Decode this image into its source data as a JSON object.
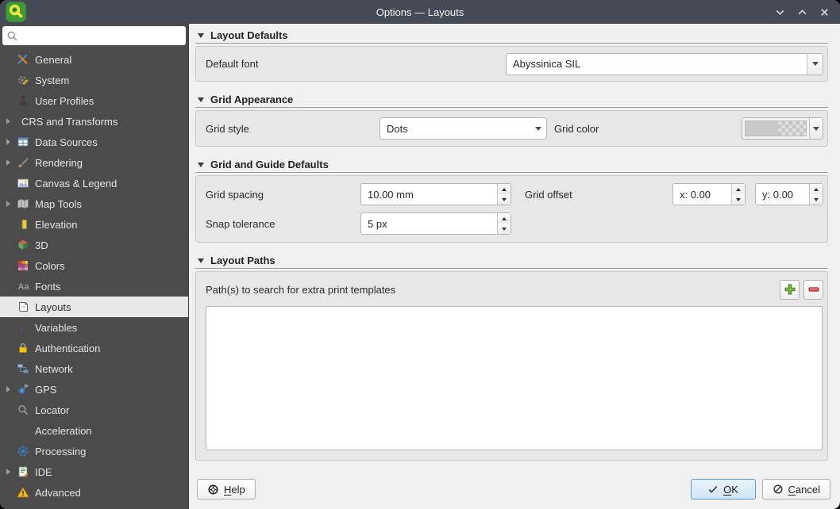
{
  "window": {
    "title": "Options — Layouts",
    "controls": {
      "minimize": "chevron-down-icon",
      "maximize": "chevron-up-icon",
      "close": "close-icon"
    }
  },
  "sidebar": {
    "search": {
      "value": "",
      "icon": "search-icon"
    },
    "items": [
      {
        "label": "General",
        "icon": "general-icon",
        "expandable": false,
        "selected": false
      },
      {
        "label": "System",
        "icon": "system-icon",
        "expandable": false,
        "selected": false
      },
      {
        "label": "User Profiles",
        "icon": "user-profiles-icon",
        "expandable": false,
        "selected": false
      },
      {
        "label": "CRS and Transforms",
        "icon": null,
        "expandable": true,
        "selected": false
      },
      {
        "label": "Data Sources",
        "icon": "data-sources-icon",
        "expandable": true,
        "selected": false
      },
      {
        "label": "Rendering",
        "icon": "rendering-icon",
        "expandable": true,
        "selected": false
      },
      {
        "label": "Canvas & Legend",
        "icon": "canvas-legend-icon",
        "expandable": false,
        "selected": false
      },
      {
        "label": "Map Tools",
        "icon": "map-tools-icon",
        "expandable": true,
        "selected": false
      },
      {
        "label": "Elevation",
        "icon": "elevation-icon",
        "expandable": false,
        "selected": false
      },
      {
        "label": "3D",
        "icon": "cube-3d-icon",
        "expandable": false,
        "selected": false
      },
      {
        "label": "Colors",
        "icon": "colors-icon",
        "expandable": false,
        "selected": false
      },
      {
        "label": "Fonts",
        "icon": "fonts-icon",
        "expandable": false,
        "selected": false
      },
      {
        "label": "Layouts",
        "icon": "layouts-icon",
        "expandable": false,
        "selected": true
      },
      {
        "label": "Variables",
        "icon": "variables-icon",
        "expandable": false,
        "selected": false
      },
      {
        "label": "Authentication",
        "icon": "authentication-icon",
        "expandable": false,
        "selected": false
      },
      {
        "label": "Network",
        "icon": "network-icon",
        "expandable": false,
        "selected": false
      },
      {
        "label": "GPS",
        "icon": "gps-icon",
        "expandable": true,
        "selected": false
      },
      {
        "label": "Locator",
        "icon": "locator-icon",
        "expandable": false,
        "selected": false
      },
      {
        "label": "Acceleration",
        "icon": "acceleration-icon",
        "expandable": false,
        "selected": false
      },
      {
        "label": "Processing",
        "icon": "processing-icon",
        "expandable": false,
        "selected": false
      },
      {
        "label": "IDE",
        "icon": "ide-icon",
        "expandable": true,
        "selected": false
      },
      {
        "label": "Advanced",
        "icon": "advanced-icon",
        "expandable": false,
        "selected": false
      }
    ]
  },
  "sections": {
    "layout_defaults": {
      "title": "Layout Defaults",
      "default_font_label": "Default font",
      "default_font_value": "Abyssinica SIL"
    },
    "grid_appearance": {
      "title": "Grid Appearance",
      "grid_style_label": "Grid style",
      "grid_style_value": "Dots",
      "grid_color_label": "Grid color",
      "grid_color_value": "semi-transparent gray swatch with alpha checkerboard"
    },
    "grid_guide_defaults": {
      "title": "Grid and Guide Defaults",
      "grid_spacing_label": "Grid spacing",
      "grid_spacing_value": "10.00 mm",
      "grid_offset_label": "Grid offset",
      "grid_offset_x": "x: 0.00",
      "grid_offset_y": "y: 0.00",
      "snap_tolerance_label": "Snap tolerance",
      "snap_tolerance_value": "5 px"
    },
    "layout_paths": {
      "title": "Layout Paths",
      "paths_label": "Path(s) to search for extra print templates",
      "paths": [],
      "add_icon": "plus-icon",
      "remove_icon": "minus-icon"
    }
  },
  "footer": {
    "help": "Help",
    "help_icon": "help-icon",
    "ok": "OK",
    "ok_icon": "check-icon",
    "cancel": "Cancel",
    "cancel_icon": "cancel-slash-icon"
  },
  "colors": {
    "titlebar_bg": "#454b54",
    "sidebar_bg": "#4b4b4b",
    "selected_item_bg": "#e7e7e7",
    "panel_bg": "#f0f0f0",
    "groupbox_bg": "#e7e7e7",
    "ok_button_bg": "#d8e9f7",
    "ok_button_border": "#5a9bd0",
    "add_button_green": "#7ab648",
    "remove_button_red": "#e04f4f",
    "warning_yellow": "#efb31c",
    "qgis_logo_green": "#3f9b35",
    "qgis_logo_yellow": "#ece83a"
  }
}
